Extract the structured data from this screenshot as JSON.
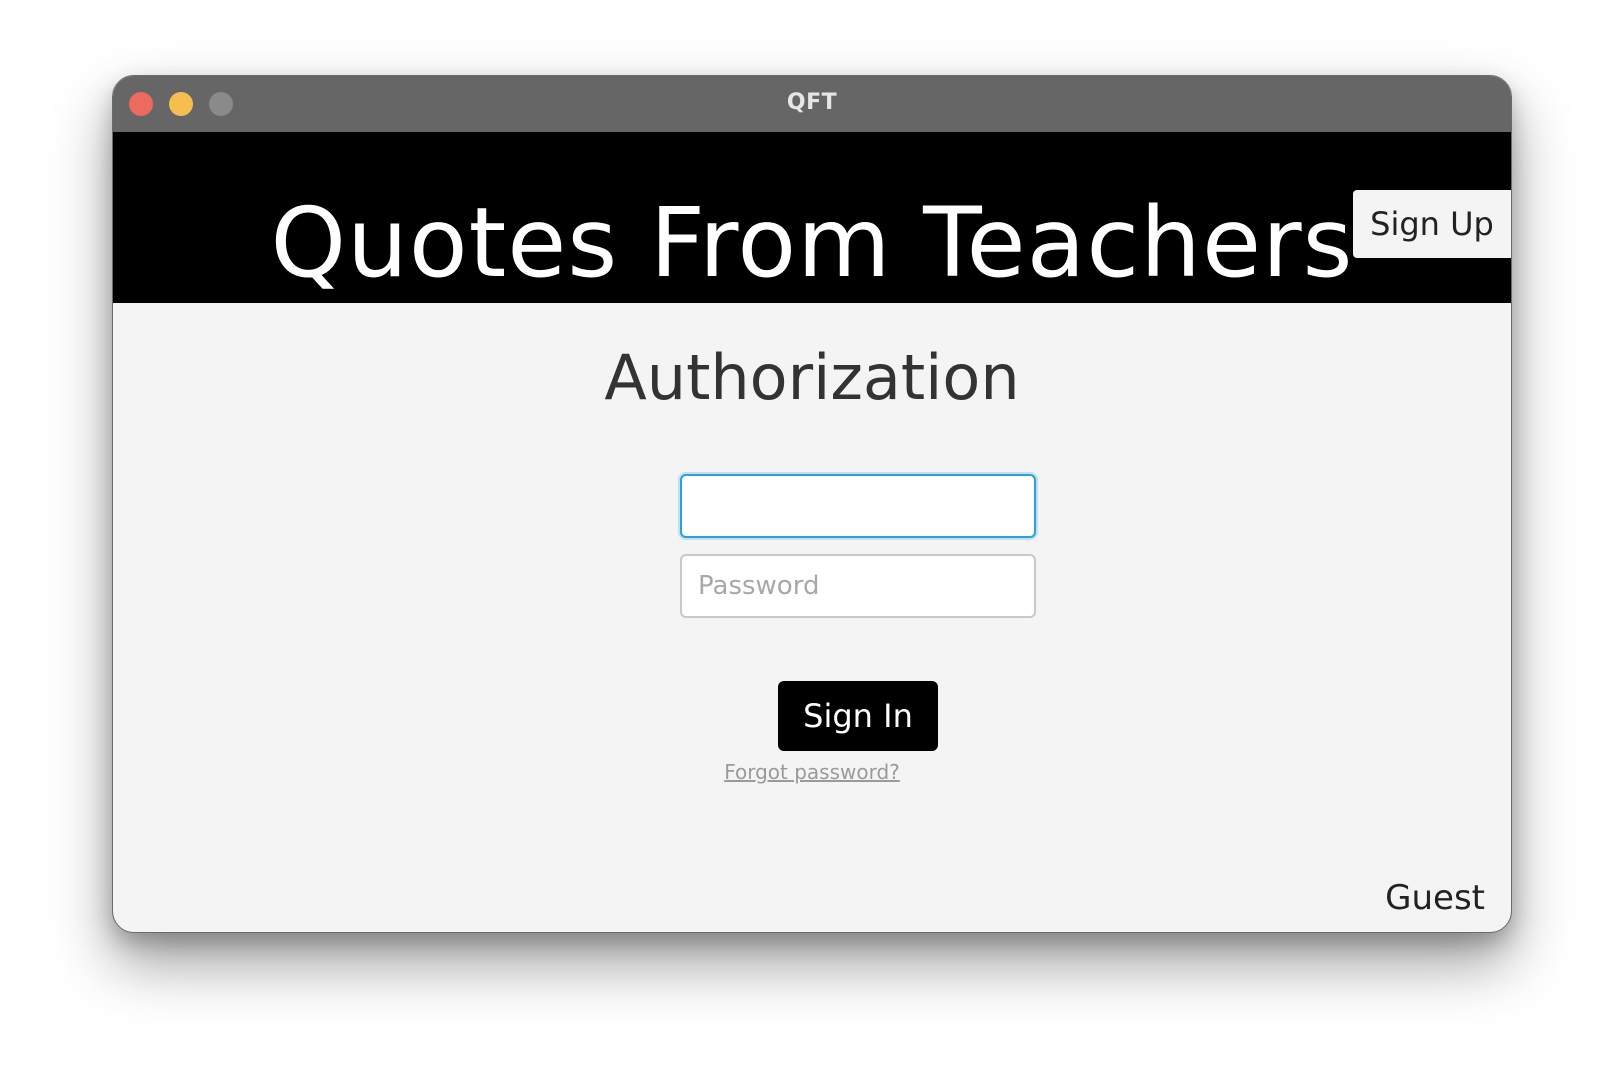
{
  "window": {
    "title": "QFT"
  },
  "header": {
    "app_title": "Quotes From Teachers",
    "signup_label": "Sign Up"
  },
  "auth": {
    "heading": "Authorization",
    "username_value": "",
    "username_placeholder": "",
    "password_placeholder": "Password",
    "signin_label": "Sign In",
    "forgot_label": "Forgot password?"
  },
  "status": {
    "user": "Guest"
  },
  "colors": {
    "header_bg": "#000000",
    "content_bg": "#f4f4f4",
    "titlebar_bg": "#666666",
    "focus_border": "#2aa1d8",
    "traffic_close": "#ed6a5e",
    "traffic_minimize": "#f4bf4f",
    "traffic_maximize": "#8a8a8a"
  }
}
